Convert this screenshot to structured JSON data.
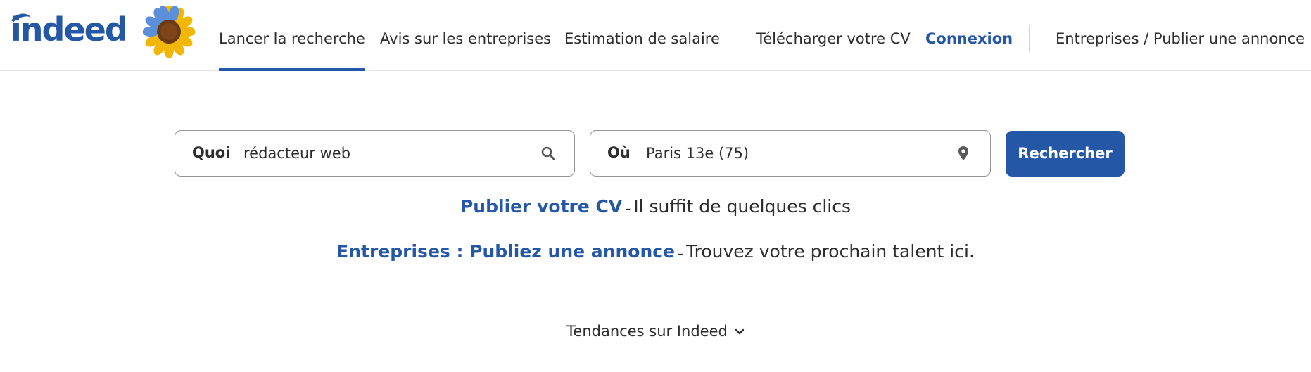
{
  "header": {
    "logo_text": "indeed",
    "nav": [
      {
        "label": "Lancer la recherche",
        "active": true
      },
      {
        "label": "Avis sur les entreprises"
      },
      {
        "label": "Estimation de salaire"
      },
      {
        "label": "Télécharger votre CV"
      },
      {
        "label": "Connexion"
      },
      {
        "label": "Entreprises / Publier une annonce"
      }
    ]
  },
  "search": {
    "what_label": "Quoi",
    "what_value": "rédacteur web",
    "where_label": "Où",
    "where_value": "Paris 13e (75)",
    "button_label": "Rechercher",
    "what_icon": "search-icon",
    "where_icon": "location-pin-icon"
  },
  "promos": {
    "cv_link": "Publier votre CV",
    "cv_dash": "–",
    "cv_text": "Il suffit de quelques clics",
    "employer_link": "Entreprises : Publiez une annonce",
    "employer_dash": "–",
    "employer_text": "Trouvez votre prochain talent ici."
  },
  "trends": {
    "label": "Tendances sur Indeed",
    "icon": "chevron-down-icon"
  },
  "colors": {
    "brand": "#2557a7",
    "text": "#2d2d2d",
    "border": "#949494"
  }
}
